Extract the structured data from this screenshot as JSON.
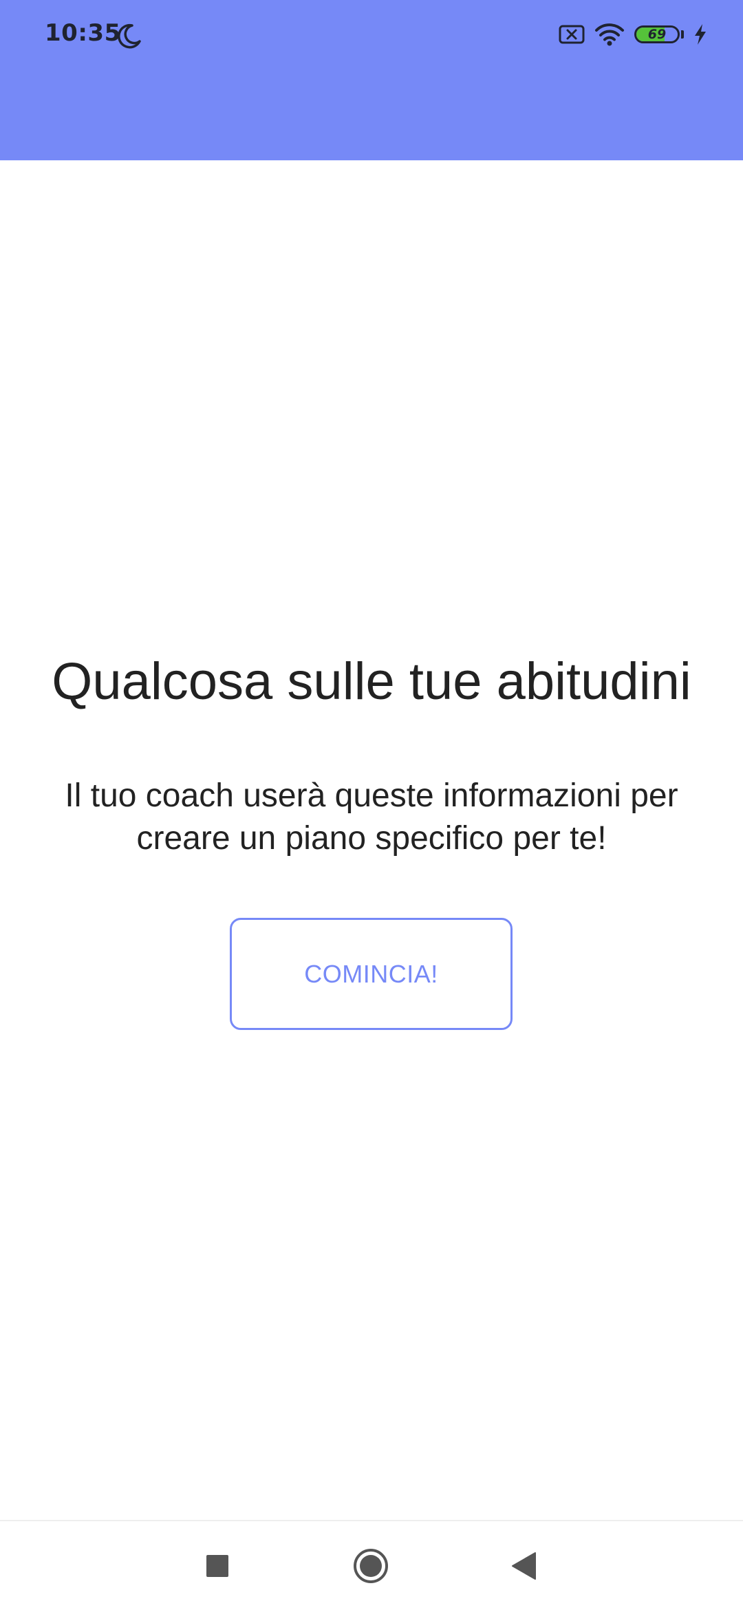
{
  "status_bar": {
    "time": "10:35",
    "battery_level": "69",
    "battery_fill_percent": 69,
    "icons": [
      "moon-icon",
      "sim-error-icon",
      "wifi-icon",
      "battery-icon",
      "charging-icon"
    ]
  },
  "main": {
    "title": "Qualcosa sulle tue abitudini",
    "subtitle": "Il tuo coach userà queste informazioni per creare un piano specifico per te!",
    "start_button_label": "COMINCIA!"
  },
  "nav_bar": {
    "icons": [
      "recents-icon",
      "home-icon",
      "back-icon"
    ]
  },
  "colors": {
    "accent": "#7689f7",
    "battery_green": "#55c23a",
    "text_dark": "#222222"
  }
}
